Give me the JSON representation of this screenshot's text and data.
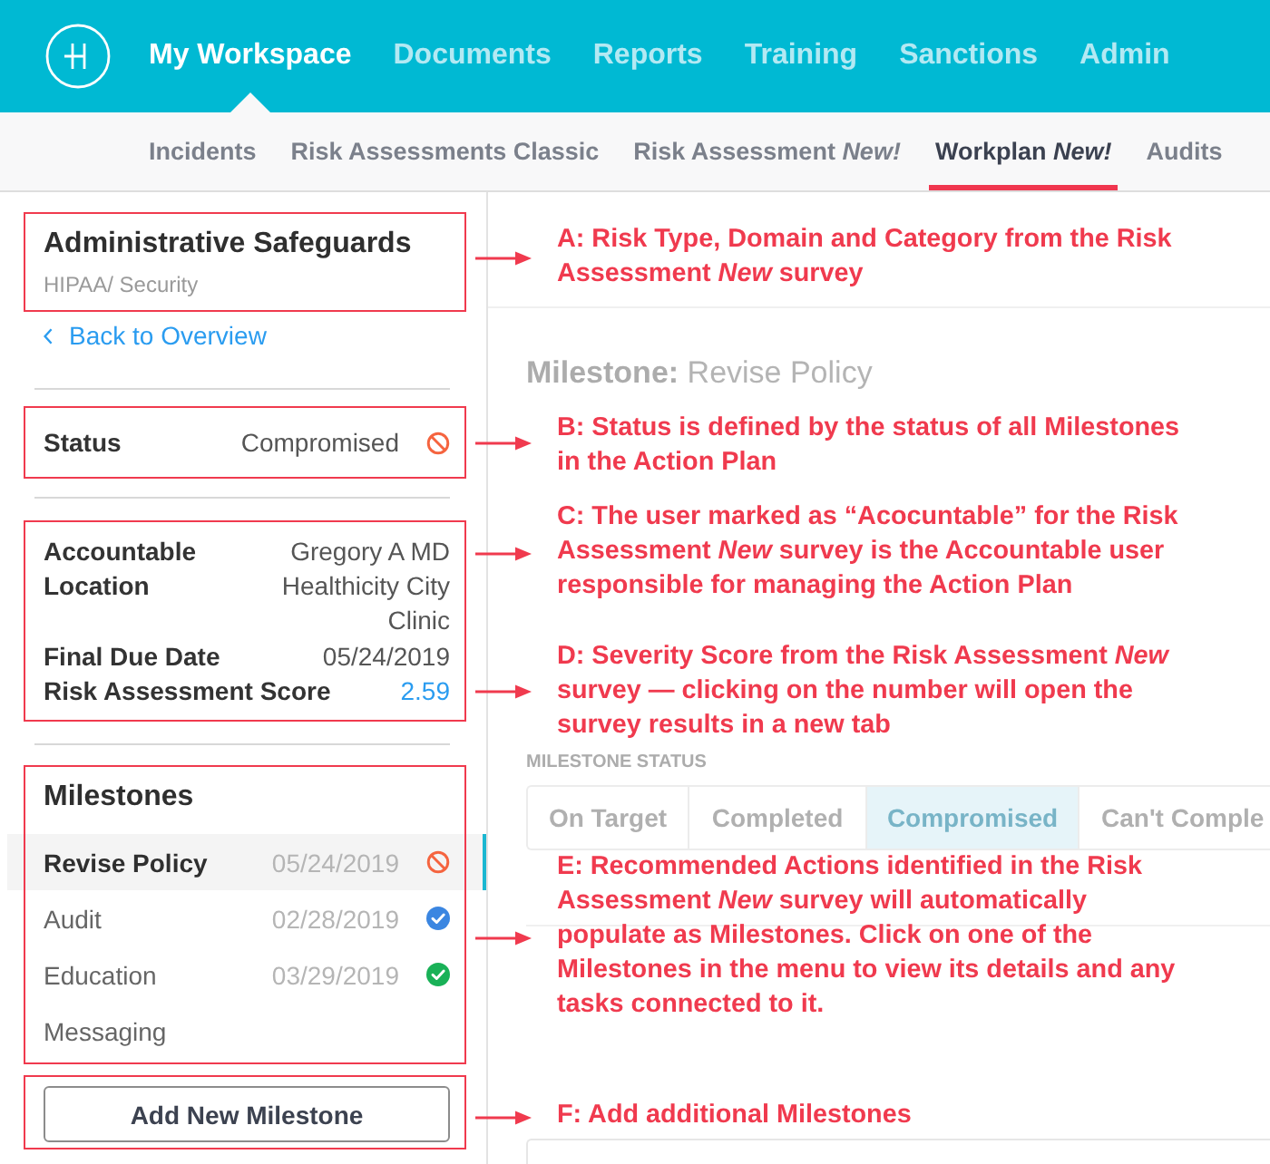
{
  "top_nav": {
    "items": [
      {
        "label": "My Workspace",
        "selected": true
      },
      {
        "label": "Documents",
        "selected": false
      },
      {
        "label": "Reports",
        "selected": false
      },
      {
        "label": "Training",
        "selected": false
      },
      {
        "label": "Sanctions",
        "selected": false
      },
      {
        "label": "Admin",
        "selected": false
      }
    ]
  },
  "sub_nav": {
    "items": [
      {
        "label": "Incidents",
        "selected": false
      },
      {
        "label": "Risk Assessments Classic",
        "selected": false
      },
      {
        "label": "Risk Assessment *New!*",
        "selected": false
      },
      {
        "label": "Workplan *New!*",
        "selected": true
      },
      {
        "label": "Audits",
        "selected": false
      }
    ]
  },
  "sidebar": {
    "title": "Administrative Safeguards",
    "subtitle": "HIPAA/ Security",
    "back_link": "Back to Overview",
    "status": {
      "label": "Status",
      "value": "Compromised",
      "kind": "ban"
    },
    "details": [
      {
        "label": "Accountable",
        "value": "Gregory A MD",
        "kind": "text"
      },
      {
        "label": "Location",
        "value": "Healthicity City Clinic",
        "kind": "text"
      },
      {
        "label": "Final Due Date",
        "value": "05/24/2019",
        "kind": "text"
      },
      {
        "label": "Risk Assessment Score",
        "value": "2.59",
        "kind": "link"
      }
    ],
    "milestones": {
      "title": "Milestones",
      "items": [
        {
          "name": "Revise Policy",
          "date": "05/24/2019",
          "kind": "ban",
          "color": "#f5643f",
          "selected": true
        },
        {
          "name": "Audit",
          "date": "02/28/2019",
          "kind": "check",
          "color": "#3b86e1",
          "selected": false
        },
        {
          "name": "Education",
          "date": "03/29/2019",
          "kind": "check",
          "color": "#19b157",
          "selected": false
        },
        {
          "name": "Messaging",
          "kind": "plain",
          "selected": false
        }
      ]
    },
    "add_button": "Add New Milestone"
  },
  "main": {
    "heading": "**Milestone:** Revise Policy",
    "status_label": "MILESTONE STATUS",
    "status_options": [
      {
        "label": "On Target",
        "selected": false
      },
      {
        "label": "Completed",
        "selected": false
      },
      {
        "label": "Compromised",
        "selected": true
      },
      {
        "label": "Can't Comple",
        "selected": false
      }
    ]
  },
  "callouts": [
    {
      "text": "A: Risk Type, Domain and Category from the Risk Assessment *New* survey"
    },
    {
      "text": "B: Status is defined by the status of all Milestones in the Action Plan"
    },
    {
      "text": "C: The user marked as “Acocuntable” for the Risk Assessment *New* survey is the Accountable user responsible for managing the Action Plan"
    },
    {
      "text": "D: Severity Score from the Risk Assessment *New* survey — clicking on the number will open the survey results in a new tab"
    },
    {
      "text": "E: Recommended Actions identified in the Risk Assessment *New* survey will automatically populate as Milestones. Click on one of the Milestones in the menu to view its details and any tasks connected to it."
    },
    {
      "text": "F: Add additional Milestones"
    }
  ]
}
